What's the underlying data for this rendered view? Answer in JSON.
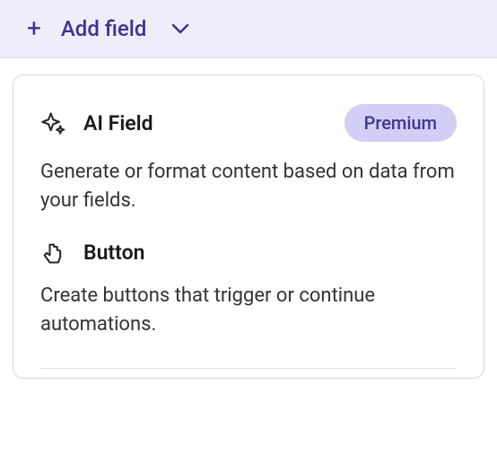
{
  "header": {
    "add_field_label": "Add field"
  },
  "dropdown": {
    "options": [
      {
        "title": "AI Field",
        "badge": "Premium",
        "description": "Generate or format content based on data from your fields."
      },
      {
        "title": "Button",
        "description": "Create buttons that trigger or continue automations."
      }
    ]
  }
}
